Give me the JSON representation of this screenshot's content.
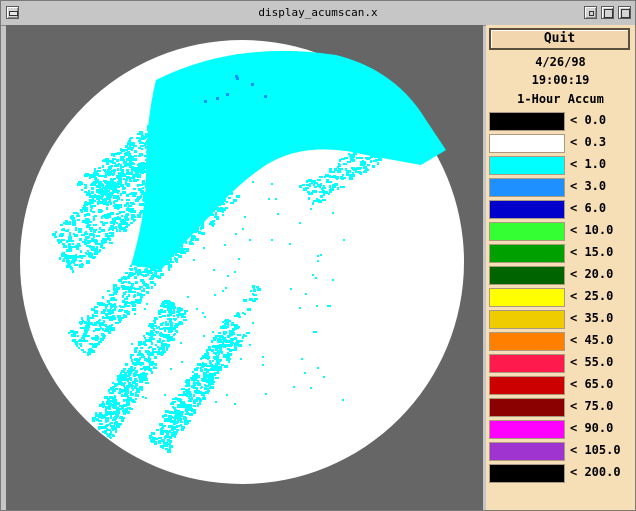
{
  "window": {
    "title": "display_acumscan.x"
  },
  "panel": {
    "quit_label": "Quit",
    "date": "4/26/98",
    "time": "19:00:19",
    "product": "1-Hour Accum"
  },
  "legend": [
    {
      "label": "< 0.0",
      "color": "#000000"
    },
    {
      "label": "< 0.3",
      "color": "#ffffff"
    },
    {
      "label": "< 1.0",
      "color": "#00ffff"
    },
    {
      "label": "< 3.0",
      "color": "#1e90ff"
    },
    {
      "label": "< 6.0",
      "color": "#0000cd"
    },
    {
      "label": "< 10.0",
      "color": "#33ff33"
    },
    {
      "label": "< 15.0",
      "color": "#00a000"
    },
    {
      "label": "< 20.0",
      "color": "#006400"
    },
    {
      "label": "< 25.0",
      "color": "#ffff00"
    },
    {
      "label": "< 35.0",
      "color": "#eecc00"
    },
    {
      "label": "< 45.0",
      "color": "#ff8000"
    },
    {
      "label": "< 55.0",
      "color": "#ff1a4d"
    },
    {
      "label": "< 65.0",
      "color": "#cc0000"
    },
    {
      "label": "< 75.0",
      "color": "#8b0000"
    },
    {
      "label": "< 90.0",
      "color": "#ff00ff"
    },
    {
      "label": "< 105.0",
      "color": "#a034d0"
    },
    {
      "label": "< 200.0",
      "color": "#000000"
    }
  ],
  "radar": {
    "background_color": "#666666",
    "disk_color": "#ffffff",
    "echo_color": "#00ffff",
    "echo_dark_color": "#1e90ff"
  }
}
